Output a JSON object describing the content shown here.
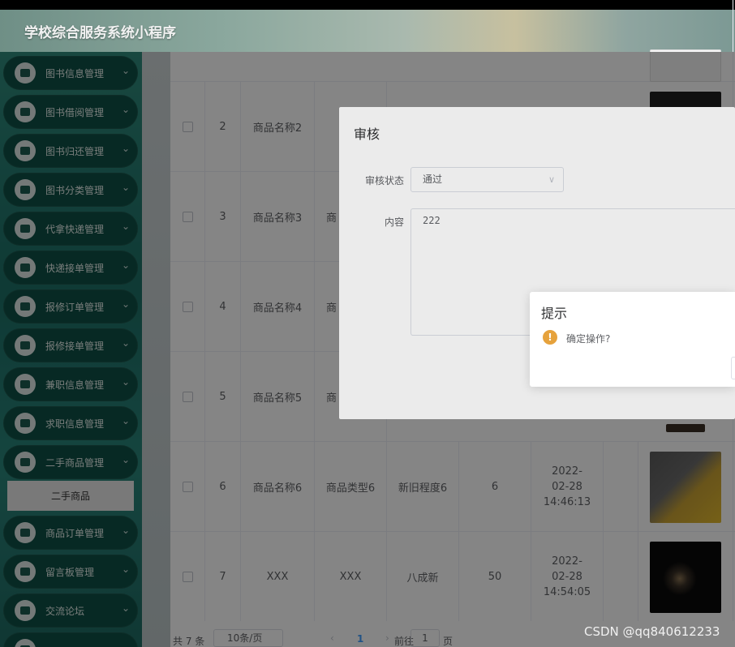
{
  "app": {
    "title": "学校综合服务系统小程序"
  },
  "sidebar": {
    "items": [
      {
        "label": "图书信息管理"
      },
      {
        "label": "图书借阅管理"
      },
      {
        "label": "图书归还管理"
      },
      {
        "label": "图书分类管理"
      },
      {
        "label": "代拿快递管理"
      },
      {
        "label": "快递接单管理"
      },
      {
        "label": "报修订单管理"
      },
      {
        "label": "报修接单管理"
      },
      {
        "label": "兼职信息管理"
      },
      {
        "label": "求职信息管理"
      },
      {
        "label": "二手商品管理"
      },
      {
        "label": "商品订单管理"
      },
      {
        "label": "留言板管理"
      },
      {
        "label": "交流论坛"
      }
    ],
    "submenu": {
      "label": "二手商品"
    }
  },
  "table": {
    "rows": [
      {
        "index": "2",
        "name": "商品名称2",
        "type": "商品",
        "condition": "",
        "qty": "",
        "time": ""
      },
      {
        "index": "3",
        "name": "商品名称3",
        "type": "商",
        "condition": "",
        "qty": "",
        "time": ""
      },
      {
        "index": "4",
        "name": "商品名称4",
        "type": "商",
        "condition": "",
        "qty": "",
        "time": ""
      },
      {
        "index": "5",
        "name": "商品名称5",
        "type": "商",
        "condition": "",
        "qty": "",
        "time": ""
      },
      {
        "index": "6",
        "name": "商品名称6",
        "type": "商品类型6",
        "condition": "新旧程度6",
        "qty": "6",
        "time": "2022-02-28 14:46:13"
      },
      {
        "index": "7",
        "name": "XXX",
        "type": "XXX",
        "condition": "八成新",
        "qty": "50",
        "time": "2022-02-28 14:54:05"
      }
    ]
  },
  "pager": {
    "total": "共 7 条",
    "size": "10条/页",
    "prev": "‹",
    "current": "1",
    "next": "›",
    "goto": "前往",
    "goto_value": "1",
    "suffix": "页"
  },
  "review_dialog": {
    "title": "审核",
    "status_label": "审核状态",
    "status_value": "通过",
    "content_label": "内容",
    "content_value": "222"
  },
  "confirm": {
    "title": "提示",
    "message": "确定操作?"
  },
  "watermark": "CSDN @qq840612233"
}
